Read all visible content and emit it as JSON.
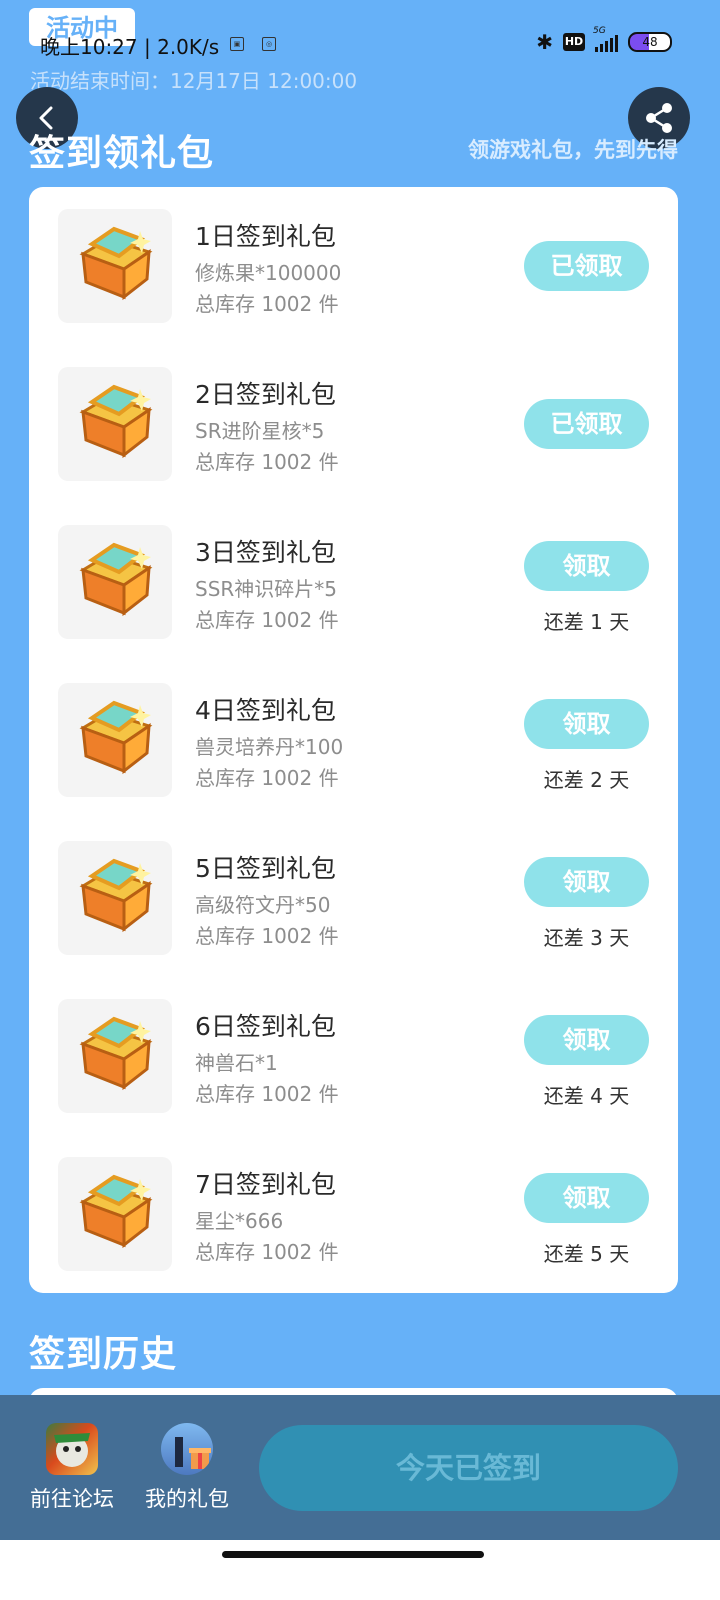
{
  "status_bar": {
    "badge": "活动中",
    "time": "晚上10:27 | 2.0K/s",
    "network_label": "5G",
    "hd_label": "HD",
    "battery": "48"
  },
  "activity": {
    "end_time": "活动结束时间：12月17日 12:00:00"
  },
  "header": {
    "title": "签到领礼包",
    "subtitle": "领游戏礼包，先到先得"
  },
  "gifts": [
    {
      "title": "1日签到礼包",
      "item": "修炼果*100000",
      "stock": "总库存 1002 件",
      "button": "已领取",
      "remain": ""
    },
    {
      "title": "2日签到礼包",
      "item": "SR进阶星核*5",
      "stock": "总库存 1002 件",
      "button": "已领取",
      "remain": ""
    },
    {
      "title": "3日签到礼包",
      "item": "SSR神识碎片*5",
      "stock": "总库存 1002 件",
      "button": "领取",
      "remain": "还差 1 天"
    },
    {
      "title": "4日签到礼包",
      "item": "兽灵培养丹*100",
      "stock": "总库存 1002 件",
      "button": "领取",
      "remain": "还差 2 天"
    },
    {
      "title": "5日签到礼包",
      "item": "高级符文丹*50",
      "stock": "总库存 1002 件",
      "button": "领取",
      "remain": "还差 3 天"
    },
    {
      "title": "6日签到礼包",
      "item": "神兽石*1",
      "stock": "总库存 1002 件",
      "button": "领取",
      "remain": "还差 4 天"
    },
    {
      "title": "7日签到礼包",
      "item": "星尘*666",
      "stock": "总库存 1002 件",
      "button": "领取",
      "remain": "还差 5 天"
    }
  ],
  "history": {
    "title": "签到历史"
  },
  "bottom": {
    "forum_label": "前往论坛",
    "gifts_label": "我的礼包",
    "sign_label": "今天已签到"
  },
  "colors": {
    "background": "#66b1f8",
    "claim_button": "#8fe2ea",
    "bottom_bar": "#446e95",
    "sign_button": "#3090b3"
  }
}
